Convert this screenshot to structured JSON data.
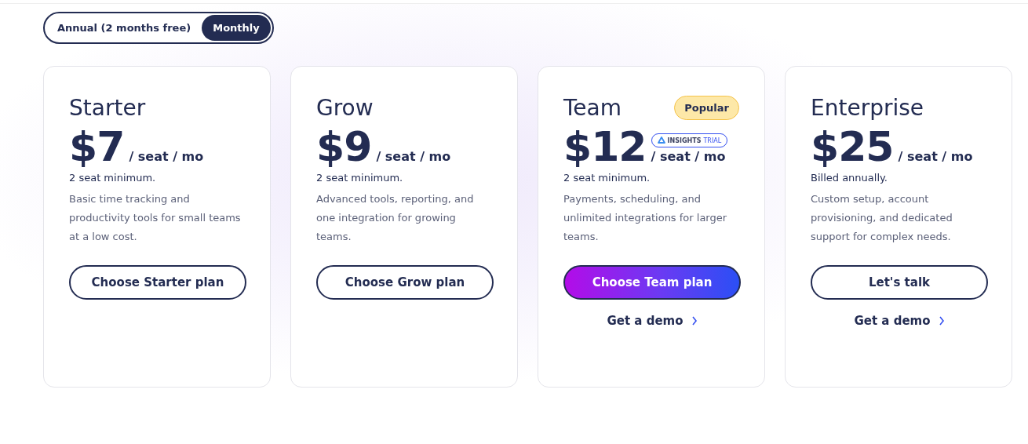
{
  "billing_toggle": [
    {
      "label": "Annual (2 months free)",
      "selected": false
    },
    {
      "label": "Monthly",
      "selected": true
    }
  ],
  "plans": [
    {
      "name": "Starter",
      "price": "$7",
      "unit": "/ seat / mo",
      "minimum": "2 seat minimum.",
      "description": "Basic time tracking and productivity tools for small teams at a low cost.",
      "cta": {
        "label": "Choose Starter plan",
        "kind": "outline"
      }
    },
    {
      "name": "Grow",
      "price": "$9",
      "unit": "/ seat / mo",
      "minimum": "2 seat minimum.",
      "description": "Advanced tools, reporting, and one integration for growing teams.",
      "cta": {
        "label": "Choose Grow plan",
        "kind": "outline"
      }
    },
    {
      "name": "Team",
      "badge": "Popular",
      "trial_badge": {
        "label": "INSIGHTS",
        "suffix": "TRIAL"
      },
      "price": "$12",
      "unit": "/ seat / mo",
      "minimum": "2 seat minimum.",
      "description": "Payments, scheduling, and unlimited integrations for larger teams.",
      "cta": {
        "label": "Choose Team plan",
        "kind": "gradient"
      },
      "demo_link": "Get a demo"
    },
    {
      "name": "Enterprise",
      "price": "$25",
      "unit": "/ seat / mo",
      "minimum": "Billed annually.",
      "description": "Custom setup, account provisioning, and dedicated support for complex needs.",
      "cta": {
        "label": "Let's talk",
        "kind": "outline"
      },
      "demo_link": "Get a demo"
    }
  ]
}
